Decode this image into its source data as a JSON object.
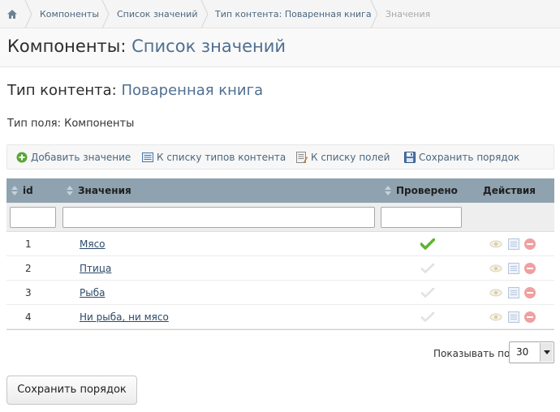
{
  "breadcrumb": {
    "items": [
      {
        "label": "Компоненты"
      },
      {
        "label": "Список значений"
      },
      {
        "label": "Тип контента: Поваренная книга"
      },
      {
        "label": "Значения"
      }
    ]
  },
  "header": {
    "title_prefix": "Компоненты:",
    "title_value": "Список значений"
  },
  "content_type": {
    "prefix": "Тип контента:",
    "value": "Поваренная книга"
  },
  "field_type": "Тип поля: Компоненты",
  "toolbar": {
    "add_label": "Добавить значение",
    "to_types_label": "К списку типов контента",
    "to_fields_label": "К списку полей",
    "save_order_label": "Сохранить порядок"
  },
  "table": {
    "columns": {
      "id": "id",
      "name": "Значения",
      "checked": "Проверено",
      "actions": "Действия"
    },
    "rows": [
      {
        "id": "1",
        "name": "Мясо",
        "checked": true
      },
      {
        "id": "2",
        "name": "Птица",
        "checked": false
      },
      {
        "id": "3",
        "name": "Рыба",
        "checked": false
      },
      {
        "id": "4",
        "name": "Ни рыба, ни мясо",
        "checked": false
      }
    ]
  },
  "pager": {
    "label": "Показывать по",
    "value": "30"
  },
  "save_button": "Сохранить порядок",
  "colors": {
    "accent": "#4f6f8f",
    "header_bar": "#8fa2b0",
    "check_green": "#5fb234",
    "delete_red": "#f0a0a0"
  }
}
